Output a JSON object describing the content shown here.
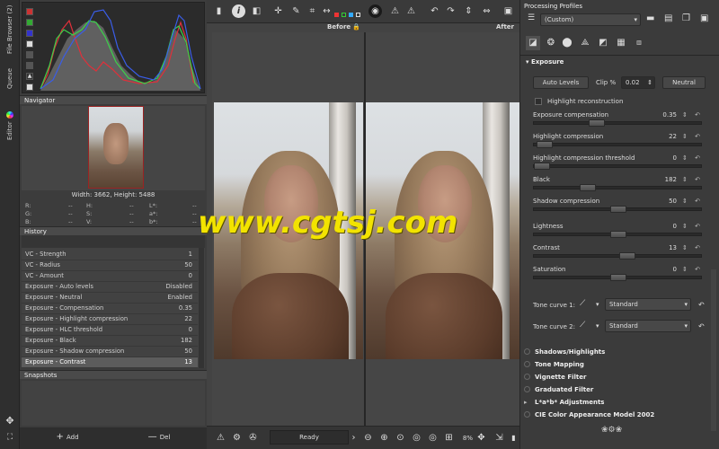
{
  "vertical_tabs": [
    "File Browser (2)",
    "Queue",
    "Editor"
  ],
  "histogram": {
    "colors": {
      "red": "#e0303a",
      "green": "#3bd24a",
      "blue": "#3a5de8",
      "luma": "#cfcfcf"
    }
  },
  "navigator": {
    "title": "Navigator",
    "dimensions": "Width: 3662, Height: 5488",
    "readout": [
      {
        "label": "R:",
        "value": "--"
      },
      {
        "label": "H:",
        "value": "--"
      },
      {
        "label": "L*:",
        "value": "--"
      },
      {
        "label": "G:",
        "value": "--"
      },
      {
        "label": "S:",
        "value": "--"
      },
      {
        "label": "a*:",
        "value": "--"
      },
      {
        "label": "B:",
        "value": "--"
      },
      {
        "label": "V:",
        "value": "--"
      },
      {
        "label": "b*:",
        "value": "--"
      }
    ]
  },
  "history": {
    "title": "History",
    "rows": [
      {
        "label": "VC - Strength",
        "value": "1"
      },
      {
        "label": "VC - Radius",
        "value": "50"
      },
      {
        "label": "VC - Amount",
        "value": "0"
      },
      {
        "label": "Exposure - Auto levels",
        "value": "Disabled"
      },
      {
        "label": "Exposure - Neutral",
        "value": "Enabled"
      },
      {
        "label": "Exposure - Compensation",
        "value": "0.35"
      },
      {
        "label": "Exposure - Highlight compression",
        "value": "22"
      },
      {
        "label": "Exposure - HLC threshold",
        "value": "0"
      },
      {
        "label": "Exposure - Black",
        "value": "182"
      },
      {
        "label": "Exposure - Shadow compression",
        "value": "50"
      },
      {
        "label": "Exposure - Contrast",
        "value": "13"
      }
    ]
  },
  "snapshots": {
    "title": "Snapshots",
    "add_label": "Add",
    "del_label": "Del"
  },
  "center": {
    "before_label": "Before",
    "after_label": "After",
    "status": "Ready",
    "zoom": "8%"
  },
  "processing_profiles": {
    "title": "Processing Profiles",
    "selected": "(Custom)"
  },
  "exposure": {
    "title": "Exposure",
    "auto_levels_label": "Auto Levels",
    "clip_label": "Clip %",
    "clip_value": "0.02",
    "neutral_label": "Neutral",
    "highlight_reconstruction_label": "Highlight reconstruction",
    "sliders": [
      {
        "label": "Exposure compensation",
        "value": "0.35",
        "fraction": 0.36
      },
      {
        "label": "Highlight compression",
        "value": "22",
        "fraction": 0.02
      },
      {
        "label": "Highlight compression threshold",
        "value": "0",
        "fraction": 0.0
      },
      {
        "label": "Black",
        "value": "182",
        "fraction": 0.3
      },
      {
        "label": "Shadow compression",
        "value": "50",
        "fraction": 0.5
      },
      {
        "label": "Lightness",
        "value": "0",
        "fraction": 0.5
      },
      {
        "label": "Contrast",
        "value": "13",
        "fraction": 0.56
      },
      {
        "label": "Saturation",
        "value": "0",
        "fraction": 0.5
      }
    ],
    "tone_curve_1_label": "Tone curve 1:",
    "tone_curve_1_value": "Standard",
    "tone_curve_2_label": "Tone curve 2:",
    "tone_curve_2_value": "Standard"
  },
  "sections": [
    "Shadows/Highlights",
    "Tone Mapping",
    "Vignette Filter",
    "Graduated Filter",
    "L*a*b* Adjustments",
    "CIE Color Appearance Model 2002"
  ],
  "watermark": "www.cgtsj.com"
}
